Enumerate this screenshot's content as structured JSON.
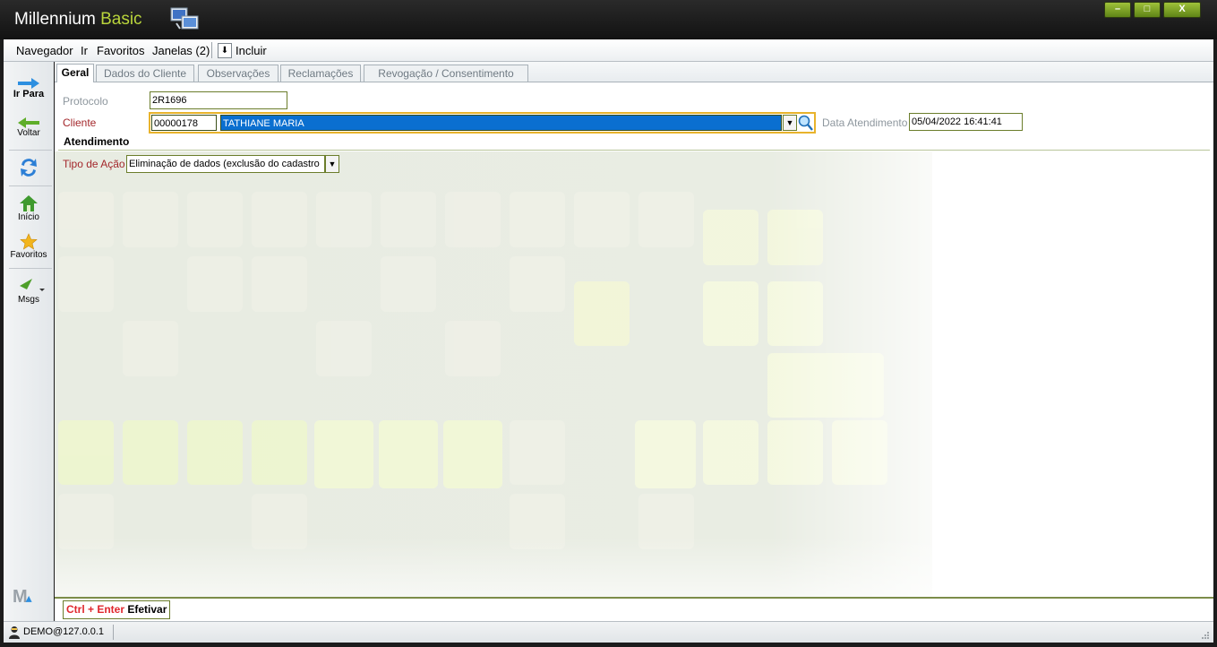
{
  "window": {
    "title_main": "Millennium",
    "title_accent": "Basic",
    "min_label": "–",
    "max_label": "□",
    "close_label": "X"
  },
  "menu": {
    "navegador": "Navegador",
    "ir": "Ir",
    "favoritos": "Favoritos",
    "janelas": "Janelas (2)",
    "incluir": "Incluir"
  },
  "sidebar": {
    "ir_para": "Ir Para",
    "voltar": "Voltar",
    "inicio": "Início",
    "favoritos": "Favoritos",
    "msgs": "Msgs"
  },
  "tabs": [
    "Geral",
    "Dados do Cliente",
    "Observações",
    "Reclamações",
    "Revogação / Consentimento"
  ],
  "form": {
    "protocolo_label": "Protocolo",
    "protocolo_value": "2R1696",
    "cliente_label": "Cliente",
    "cliente_code": "00000178",
    "cliente_name": "TATHIANE MARIA",
    "data_label": "Data Atendimento",
    "data_value": "05/04/2022 16:41:41",
    "section_title": "Atendimento",
    "tipo_label": "Tipo de Ação",
    "tipo_value": "Eliminação de dados (exclusão do cadastro"
  },
  "footer": {
    "shortcut": "Ctrl + Enter",
    "action": "Efetivar"
  },
  "status": {
    "user": "DEMO@127.0.0.1"
  }
}
